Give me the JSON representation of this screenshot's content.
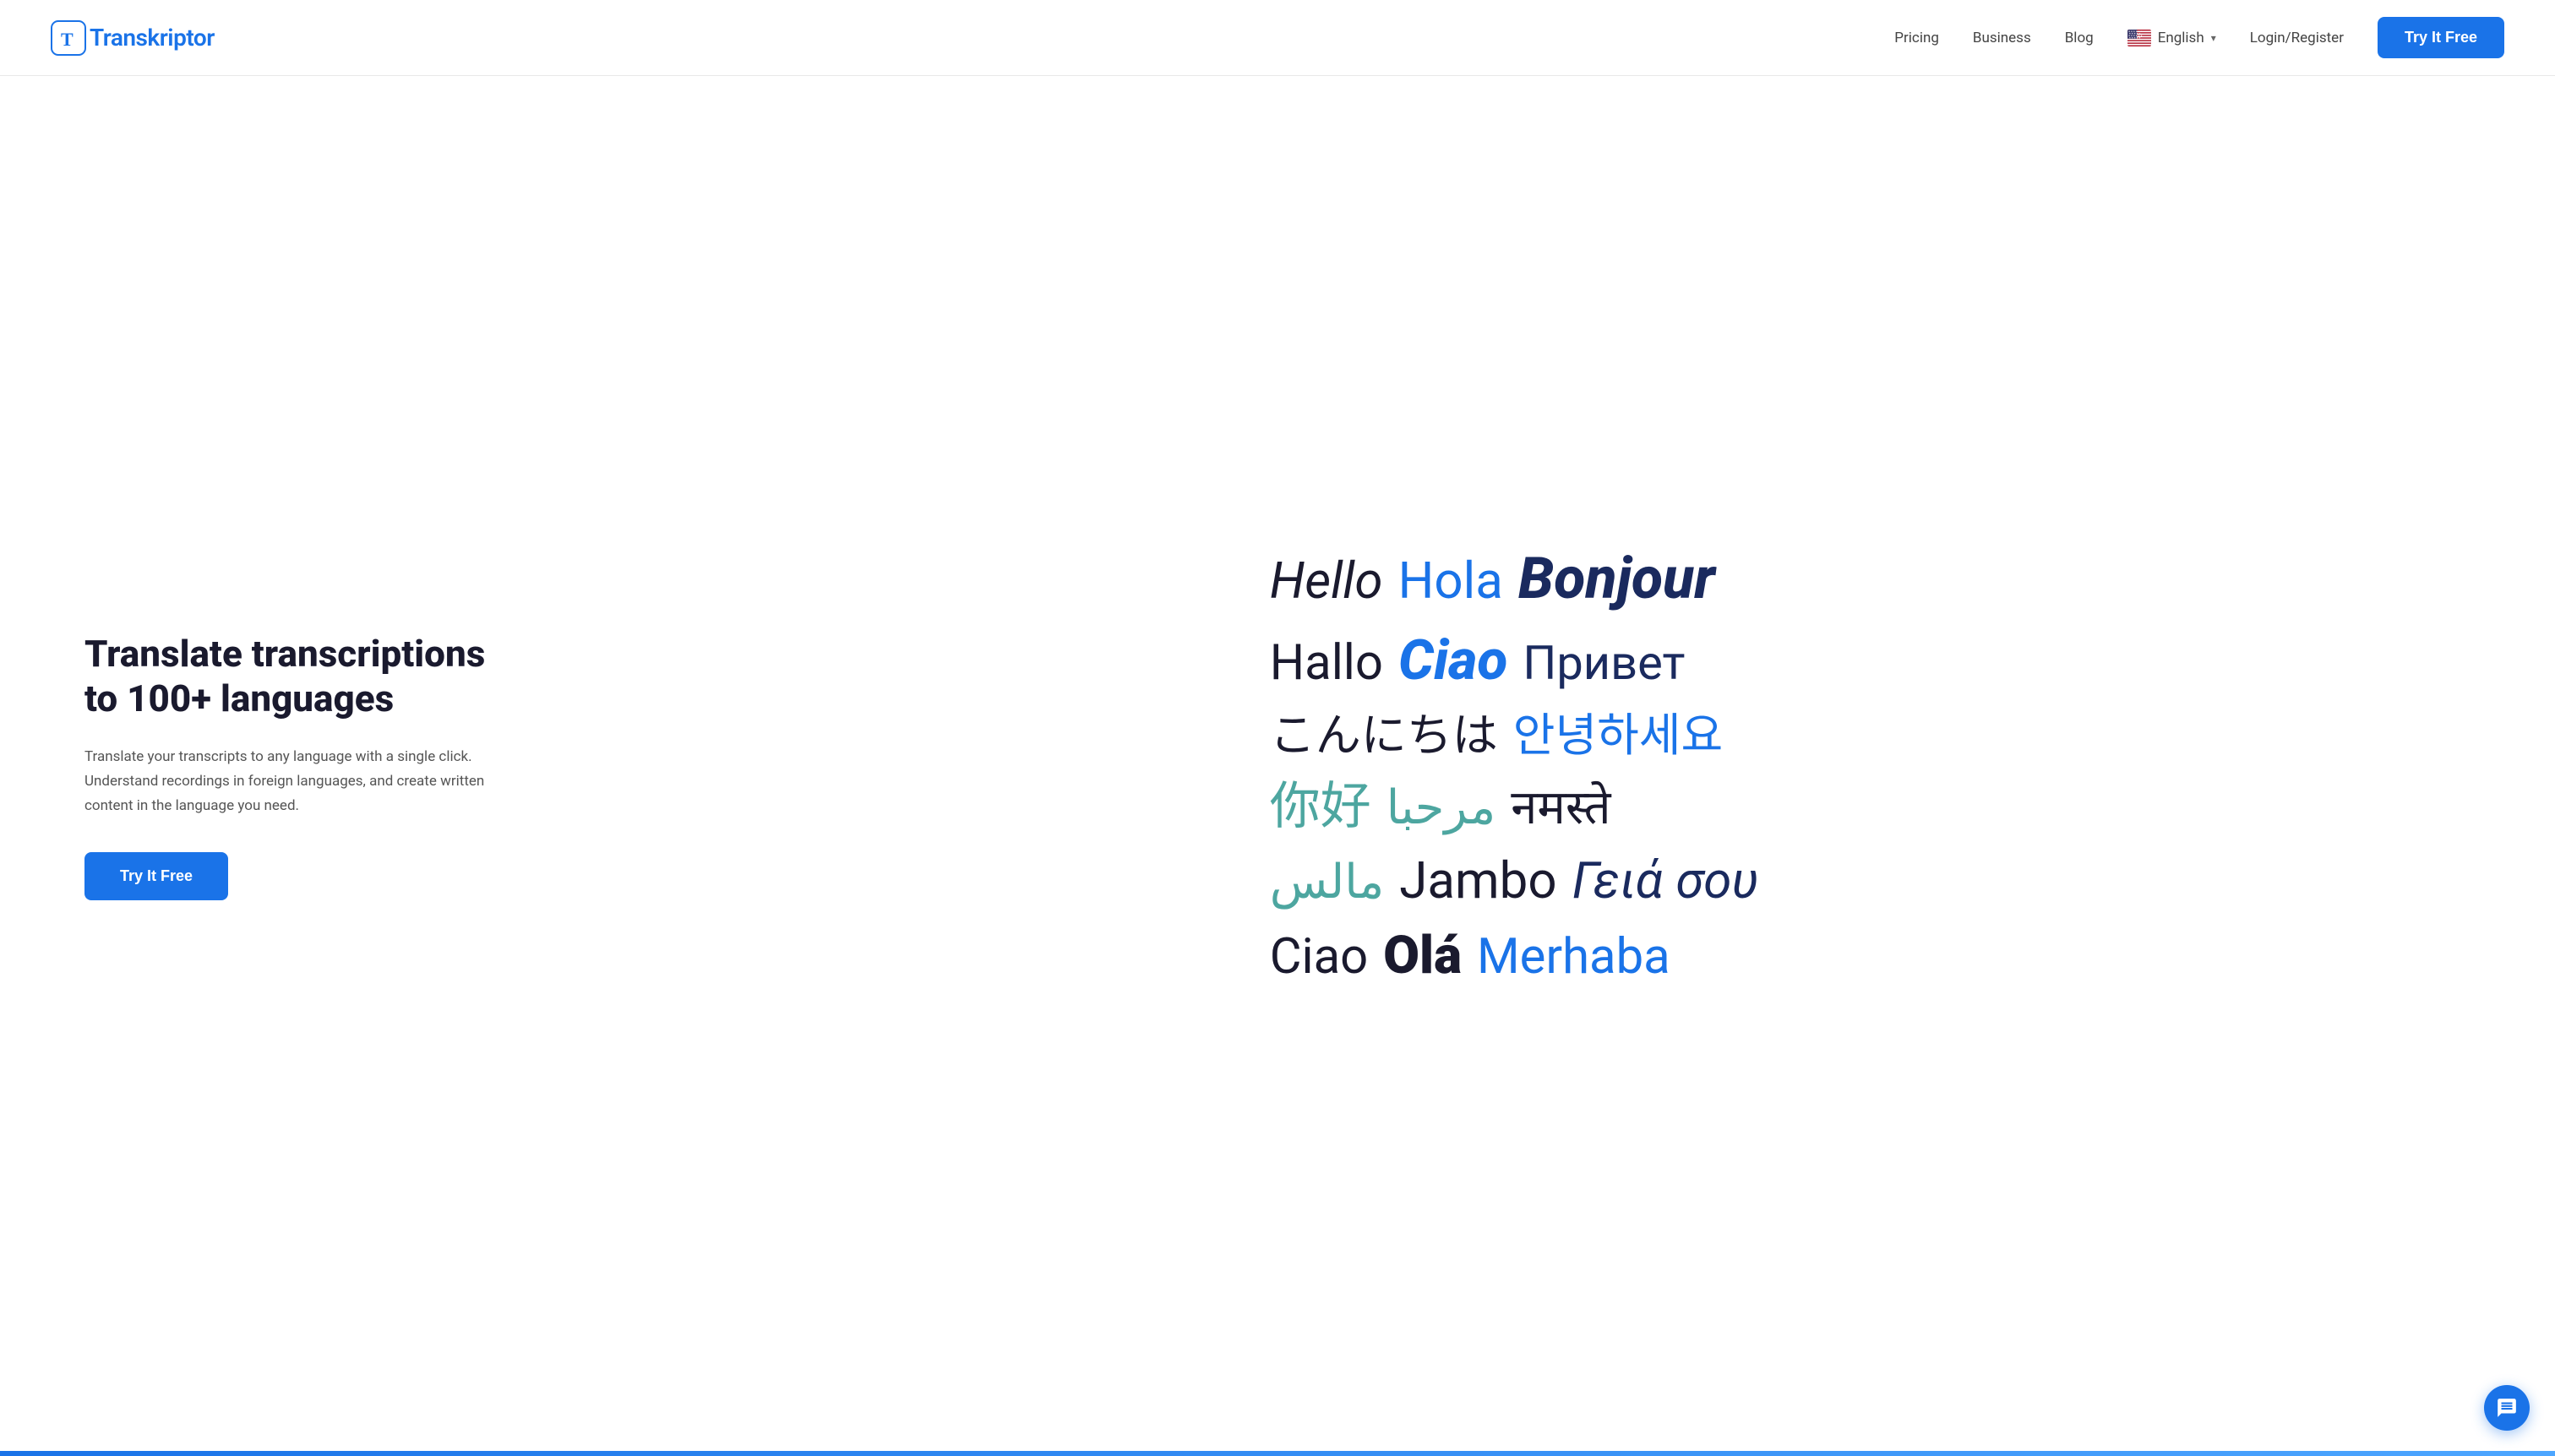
{
  "navbar": {
    "logo_text": "Transkriptor",
    "links": [
      {
        "label": "Pricing",
        "id": "pricing"
      },
      {
        "label": "Business",
        "id": "business"
      },
      {
        "label": "Blog",
        "id": "blog"
      }
    ],
    "language": {
      "label": "English",
      "chevron": "▾"
    },
    "login_label": "Login/Register",
    "try_btn_label": "Try It Free"
  },
  "hero": {
    "title": "Translate transcriptions to 100+ languages",
    "description": "Translate your transcripts to any language with a single click. Understand recordings in foreign languages, and create written content in the language you need.",
    "try_btn_label": "Try It Free"
  },
  "language_cloud": {
    "rows": [
      [
        {
          "text": "Hello",
          "style": "dark-italic"
        },
        {
          "text": "Hola",
          "style": "blue"
        },
        {
          "text": "Bonjour",
          "style": "navy-bold-italic"
        }
      ],
      [
        {
          "text": "Hallo",
          "style": "dark"
        },
        {
          "text": "Ciao",
          "style": "blue-bold-italic"
        },
        {
          "text": "Привет",
          "style": "navy"
        }
      ],
      [
        {
          "text": "こんにちは",
          "style": "dark"
        },
        {
          "text": "안녕하세요",
          "style": "blue"
        }
      ],
      [
        {
          "text": "你好",
          "style": "teal"
        },
        {
          "text": "مرحبا",
          "style": "teal"
        },
        {
          "text": "नमस्ते",
          "style": "dark"
        }
      ],
      [
        {
          "text": "مالس",
          "style": "teal"
        },
        {
          "text": "Jambo",
          "style": "dark"
        },
        {
          "text": "Γειά σου",
          "style": "navy-italic"
        }
      ],
      [
        {
          "text": "Ciao",
          "style": "dark"
        },
        {
          "text": "Olá",
          "style": "dark-bold"
        },
        {
          "text": "Merhaba",
          "style": "blue"
        }
      ]
    ]
  },
  "chat": {
    "icon": "💬"
  }
}
